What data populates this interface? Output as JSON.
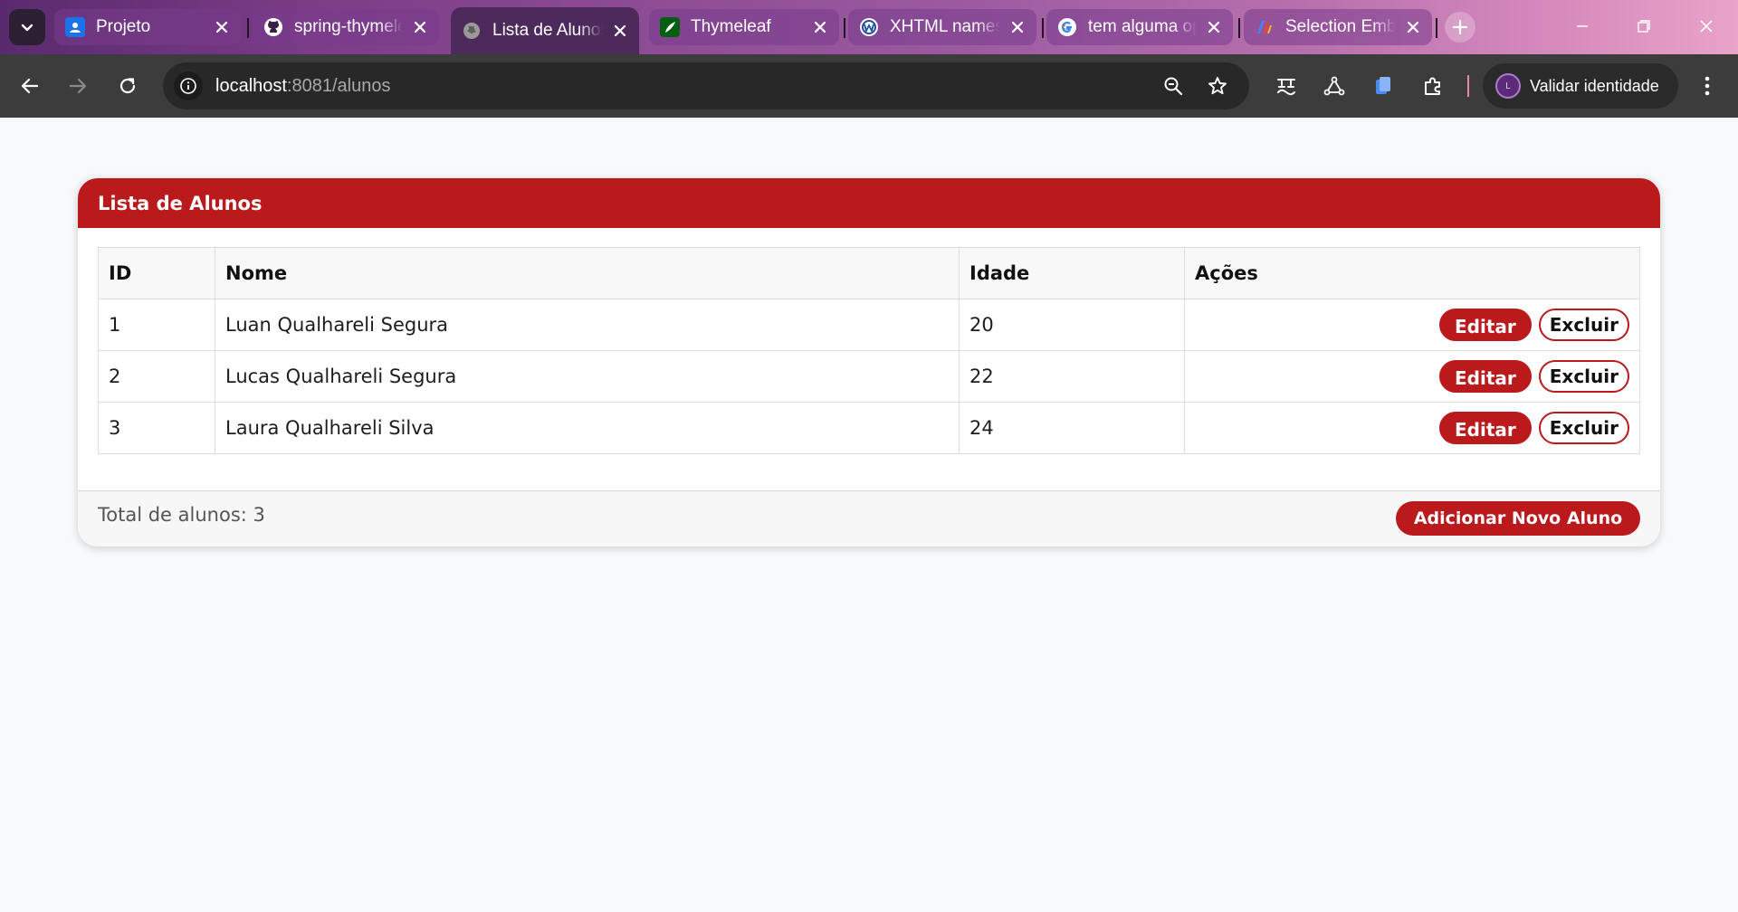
{
  "browser": {
    "tabs": [
      {
        "title": "Projeto",
        "icon": "google-classroom-icon"
      },
      {
        "title": "spring-thymeleaf",
        "icon": "github-icon"
      },
      {
        "title": "Lista de Alunos",
        "icon": "globe-icon",
        "active": true
      },
      {
        "title": "Thymeleaf",
        "icon": "thymeleaf-leaf-icon"
      },
      {
        "title": "XHTML namespace",
        "icon": "w3-icon"
      },
      {
        "title": "tem alguma op",
        "icon": "google-icon"
      },
      {
        "title": "Selection Emb",
        "icon": "app-logo-icon"
      }
    ],
    "address": {
      "host": "localhost",
      "path": ":8081/alunos"
    },
    "profile_label": "Validar identidade",
    "profile_initial": "L",
    "accent_colors": {
      "active_tab": "#4d2a5c",
      "toolbar": "#3c3c3c",
      "omnibox": "#282828"
    }
  },
  "page": {
    "header_title": "Lista de Alunos",
    "table": {
      "headers": [
        "ID",
        "Nome",
        "Idade",
        "Ações"
      ],
      "rows": [
        {
          "id": "1",
          "nome": "Luan Qualhareli Segura",
          "idade": "20"
        },
        {
          "id": "2",
          "nome": "Lucas Qualhareli Segura",
          "idade": "22"
        },
        {
          "id": "3",
          "nome": "Laura Qualhareli Silva",
          "idade": "24"
        }
      ],
      "edit_label": "Editar",
      "delete_label": "Excluir"
    },
    "footer": {
      "total_text": "Total de alunos: 3",
      "add_button_label": "Adicionar Novo Aluno"
    },
    "colors": {
      "primary": "#bb1a1d",
      "background": "#f8f9fb"
    }
  }
}
